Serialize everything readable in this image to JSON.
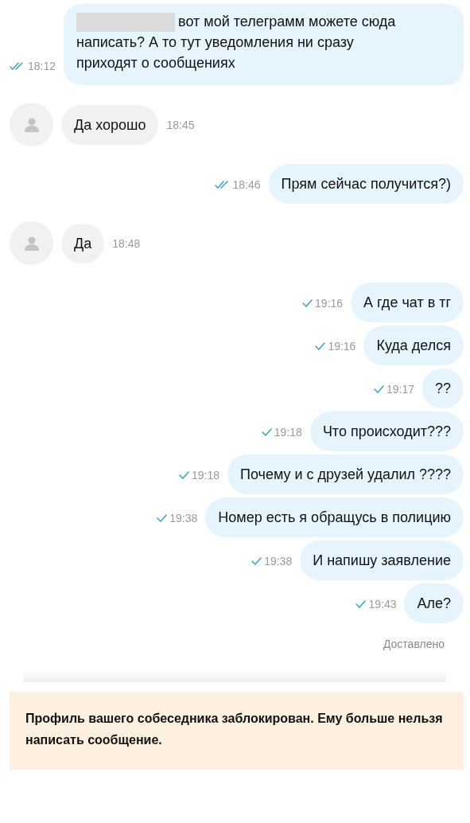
{
  "messages": [
    {
      "kind": "outgoing",
      "redacted": true,
      "text": "вот мой телеграмм можете сюда написать? А то тут уведомления ни сразу приходят о сообщениях",
      "time": "18:12",
      "read": true
    },
    {
      "kind": "incoming",
      "text": "Да хорошо",
      "time": "18:45"
    },
    {
      "kind": "outgoing",
      "text": "Прям сейчас получится?)",
      "time": "18:46",
      "read": true
    },
    {
      "kind": "incoming",
      "text": "Да",
      "time": "18:48"
    },
    {
      "kind": "outgoing",
      "text": "А где чат в тг",
      "time": "19:16",
      "read": false
    },
    {
      "kind": "outgoing",
      "text": "Куда делся",
      "time": "19:16",
      "read": false
    },
    {
      "kind": "outgoing",
      "text": "??",
      "time": "19:17",
      "read": false
    },
    {
      "kind": "outgoing",
      "text": "Что происходит???",
      "time": "19:18",
      "read": false
    },
    {
      "kind": "outgoing",
      "text": "Почему и с друзей удалил ????",
      "time": "19:18",
      "read": false
    },
    {
      "kind": "outgoing",
      "text": "Номер есть я обращусь в полицию",
      "time": "19:38",
      "read": false
    },
    {
      "kind": "outgoing",
      "text": "И напишу заявление",
      "time": "19:38",
      "read": false
    },
    {
      "kind": "outgoing",
      "text": "Але?",
      "time": "19:43",
      "read": false
    }
  ],
  "delivery_status": "Доставлено",
  "blocked_notice": "Профиль вашего собеседника заблокирован. Ему больше нельзя написать сообщение."
}
